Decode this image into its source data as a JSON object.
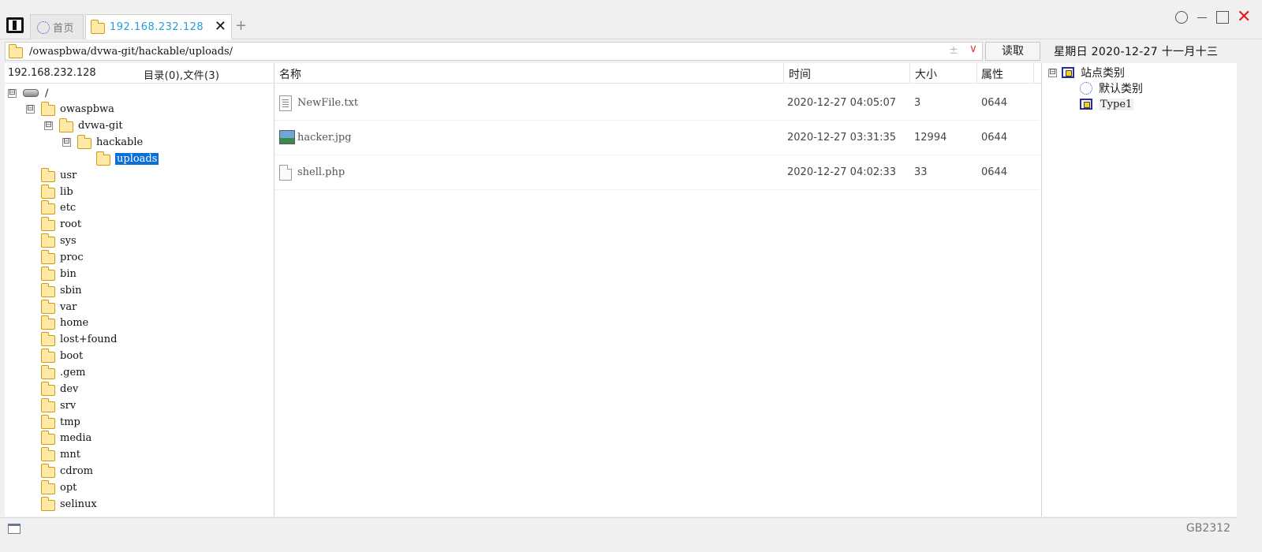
{
  "tabs": {
    "home_label": "首页",
    "active_label": "192.168.232.128",
    "close_glyph": "✕",
    "new_tab_glyph": "+"
  },
  "address": {
    "path": "/owaspbwa/dvwa-git/hackable/uploads/",
    "plusminus_glyph": "±",
    "dropdown_glyph": "∨",
    "read_label": "读取",
    "date_text": "星期日  2020-12-27  十一月十三"
  },
  "left": {
    "host": "192.168.232.128",
    "counts": "目录(0),文件(3)",
    "tree": [
      {
        "label": "/",
        "type": "drive",
        "toggle": "⊟"
      },
      {
        "label": "owaspbwa",
        "type": "folder",
        "toggle": "⊟"
      },
      {
        "label": "dvwa-git",
        "type": "folder",
        "toggle": "⊟"
      },
      {
        "label": "hackable",
        "type": "folder",
        "toggle": "⊟"
      },
      {
        "label": "uploads",
        "type": "folder",
        "selected": true
      },
      {
        "label": "usr",
        "type": "folder"
      },
      {
        "label": "lib",
        "type": "folder"
      },
      {
        "label": "etc",
        "type": "folder"
      },
      {
        "label": "root",
        "type": "folder"
      },
      {
        "label": "sys",
        "type": "folder"
      },
      {
        "label": "proc",
        "type": "folder"
      },
      {
        "label": "bin",
        "type": "folder"
      },
      {
        "label": "sbin",
        "type": "folder"
      },
      {
        "label": "var",
        "type": "folder"
      },
      {
        "label": "home",
        "type": "folder"
      },
      {
        "label": "lost+found",
        "type": "folder"
      },
      {
        "label": "boot",
        "type": "folder"
      },
      {
        "label": ".gem",
        "type": "folder"
      },
      {
        "label": "dev",
        "type": "folder"
      },
      {
        "label": "srv",
        "type": "folder"
      },
      {
        "label": "tmp",
        "type": "folder"
      },
      {
        "label": "media",
        "type": "folder"
      },
      {
        "label": "mnt",
        "type": "folder"
      },
      {
        "label": "cdrom",
        "type": "folder"
      },
      {
        "label": "opt",
        "type": "folder"
      },
      {
        "label": "selinux",
        "type": "folder"
      }
    ]
  },
  "files": {
    "columns": {
      "name": "名称",
      "time": "时间",
      "size": "大小",
      "attr": "属性"
    },
    "rows": [
      {
        "icon": "txt",
        "name": "NewFile.txt",
        "time": "2020-12-27 04:05:07",
        "size": "3",
        "attr": "0644"
      },
      {
        "icon": "img",
        "name": "hacker.jpg",
        "time": "2020-12-27 03:31:35",
        "size": "12994",
        "attr": "0644"
      },
      {
        "icon": "php",
        "name": "shell.php",
        "time": "2020-12-27 04:02:33",
        "size": "33",
        "attr": "0644"
      }
    ]
  },
  "categories": {
    "root_label": "站点类别",
    "toggle": "⊟",
    "items": [
      {
        "label": "默认类别",
        "icon": "circle"
      },
      {
        "label": "Type1",
        "icon": "box"
      }
    ]
  },
  "status": {
    "encoding": "GB2312"
  }
}
